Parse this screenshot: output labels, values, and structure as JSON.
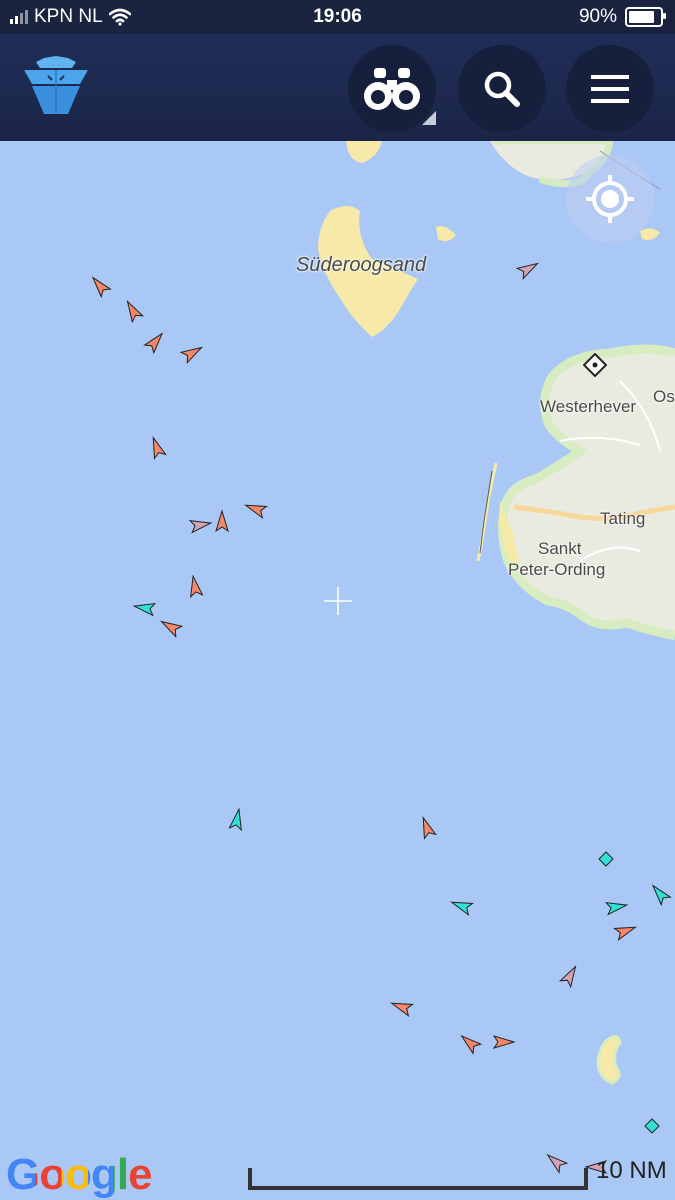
{
  "status_bar": {
    "carrier": "KPN NL",
    "time": "19:06",
    "battery": "90%",
    "battery_level": 0.9
  },
  "app_bar": {
    "logo_icon": "ship-logo-icon",
    "buttons": [
      {
        "name": "binoculars-button",
        "icon": "binoculars-icon"
      },
      {
        "name": "search-button",
        "icon": "search-icon"
      },
      {
        "name": "menu-button",
        "icon": "hamburger-menu-icon"
      }
    ]
  },
  "map": {
    "place_labels": {
      "suderoogsand": "Süderoogsand",
      "westerhever": "Westerhever",
      "os": "Os",
      "tating": "Tating",
      "sankt": "Sankt",
      "peter_ording": "Peter-Ording"
    },
    "attribution": "Google",
    "scale_label": "10 NM",
    "colors": {
      "sea": "#aac8f5",
      "land": "#e9ebe0",
      "sand": "#f7e9a8",
      "cargo": "#f5876a",
      "passenger": "#33e0d8",
      "other": "#d4a3b3"
    }
  }
}
